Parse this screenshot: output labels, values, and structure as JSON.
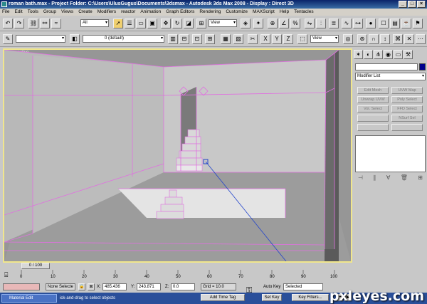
{
  "window": {
    "title": "roman bath.max    - Project Folder: C:\\Users\\UlusGugus\\Documents\\3dsmax    - Autodesk 3ds Max 2008    - Display : Direct 3D",
    "buttons": [
      "_",
      "□",
      "×"
    ]
  },
  "menu": [
    "File",
    "Edit",
    "Tools",
    "Group",
    "Views",
    "Create",
    "Modifiers",
    "reactor",
    "Animation",
    "Graph Editors",
    "Rendering",
    "Customize",
    "MAXScript",
    "Help",
    "Tentacles"
  ],
  "toolbar": {
    "selection_filter": "All",
    "reference_coord": "View",
    "reference_coord2": "View",
    "layer": "0 (default)"
  },
  "viewport": {
    "label": "Perspective"
  },
  "command_panel": {
    "modifier_list": "Modifier List",
    "modifier_buttons": [
      "Edit Mesh",
      "UVW Map",
      "Unwrap UVW",
      "Poly Select",
      "Vol. Select",
      "FFD Select",
      "",
      "NSurf Sel",
      "",
      ""
    ]
  },
  "timeline": {
    "slider_label": "0 / 100",
    "ticks": [
      "0",
      "10",
      "20",
      "30",
      "40",
      "50",
      "60",
      "70",
      "80",
      "90",
      "100"
    ]
  },
  "status": {
    "selection": "None Selecte",
    "x_label": "X:",
    "x_value": "485.436",
    "y_label": "Y:",
    "y_value": "243.871",
    "z_label": "Z:",
    "z_value": "0.0",
    "grid": "Grid = 10.0",
    "add_time_tag": "Add Time Tag",
    "auto_key": "Auto Key",
    "auto_key_mode": "Selected",
    "set_key": "Set Key",
    "key_filters": "Key Filters..."
  },
  "taskbar": {
    "item": "Material Edit",
    "prompt": "ick-and-drag to select objects"
  },
  "watermark": "pxleyes.com",
  "colors": {
    "wireframe": "#e070e0",
    "active_border": "#f0e68c",
    "line": "#2244cc"
  }
}
